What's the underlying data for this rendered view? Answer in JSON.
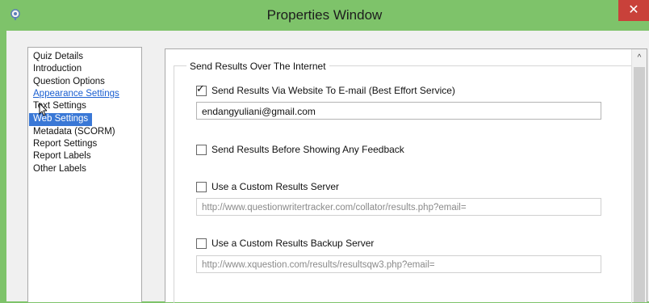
{
  "window": {
    "title": "Properties Window",
    "close_glyph": "✕",
    "app_icon": "app-icon"
  },
  "nav": {
    "items": [
      {
        "label": "Quiz Details"
      },
      {
        "label": "Introduction"
      },
      {
        "label": "Question Options"
      },
      {
        "label": "Appearance Settings"
      },
      {
        "label": "Text Settings"
      },
      {
        "label": "Web Settings"
      },
      {
        "label": "Metadata (SCORM)"
      },
      {
        "label": "Report Settings"
      },
      {
        "label": "Report Labels"
      },
      {
        "label": "Other Labels"
      }
    ],
    "hovered": "Appearance Settings",
    "selected": "Web Settings"
  },
  "panel": {
    "group_title": "Send Results Over The Internet",
    "send_via_website": {
      "label": "Send Results Via Website To E-mail (Best Effort Service)",
      "checked": true
    },
    "email": {
      "value": "endangyuliani@gmail.com"
    },
    "send_before_feedback": {
      "label": "Send Results Before Showing Any Feedback",
      "checked": false
    },
    "custom_server": {
      "label": "Use a Custom Results Server",
      "checked": false,
      "url": "http://www.questionwritertracker.com/collator/results.php?email="
    },
    "backup_server": {
      "label": "Use a Custom Results Backup Server",
      "checked": false,
      "url": "http://www.xquestion.com/results/resultsqw3.php?email="
    }
  },
  "scrollbar": {
    "up_glyph": "^"
  },
  "colors": {
    "titlebar": "#7ec36a",
    "close": "#c9413a",
    "selection": "#3a78d6",
    "link": "#1a5fd1"
  }
}
